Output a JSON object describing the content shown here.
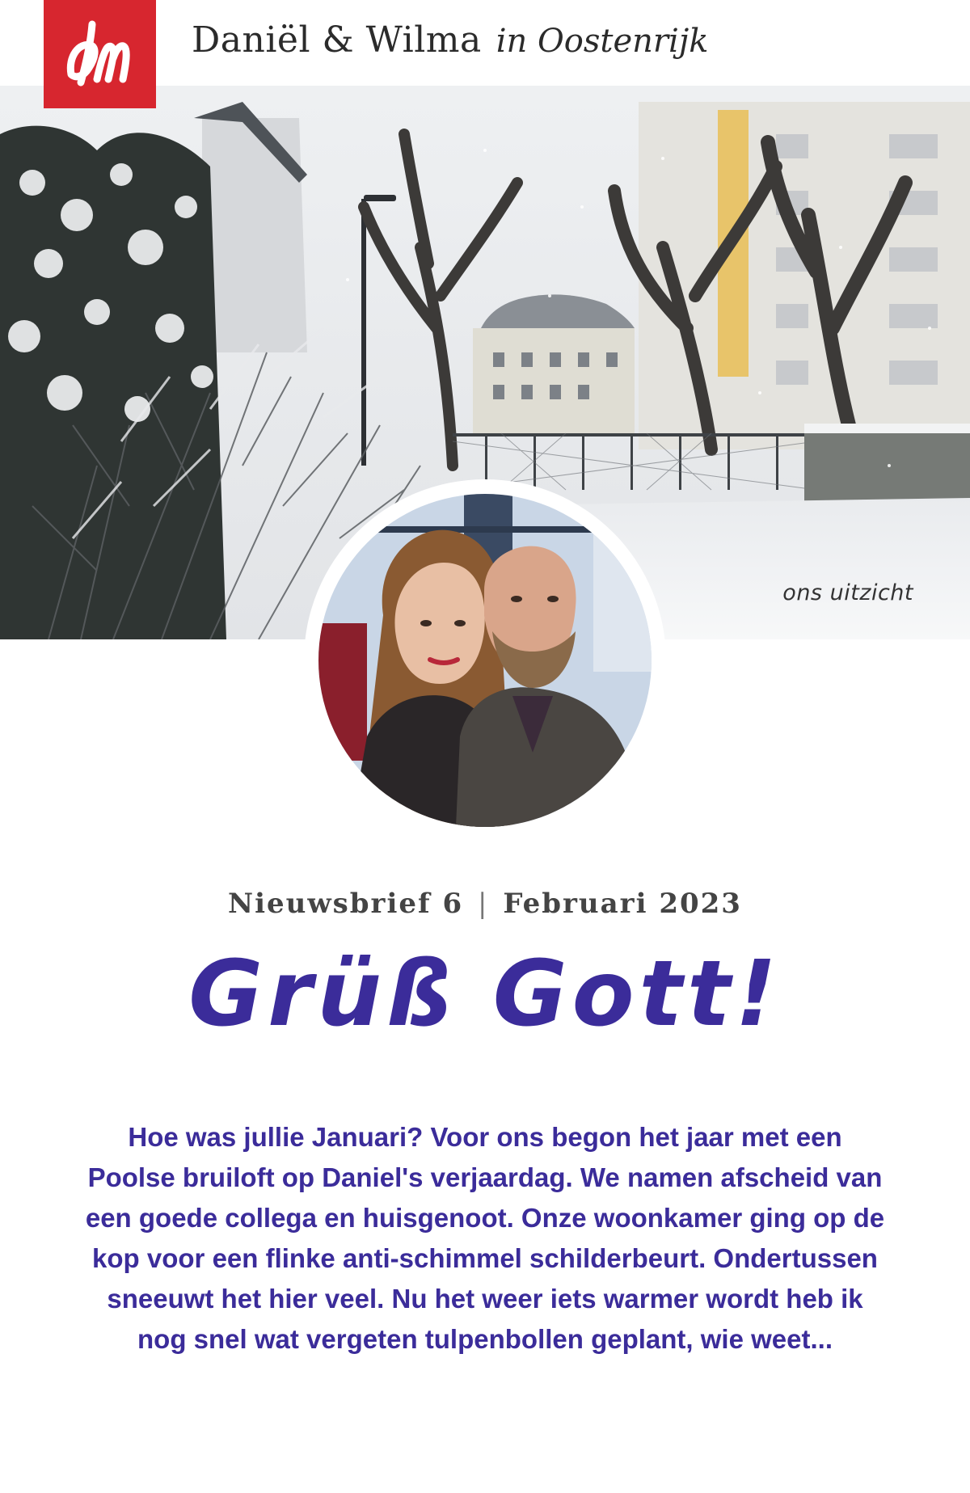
{
  "header": {
    "logo_monogram": "dm",
    "site_title_names": "Daniël & Wilma",
    "site_title_place": "in Oostenrijk"
  },
  "hero": {
    "caption": "ons uitzicht"
  },
  "newsletter": {
    "issue": "Nieuwsbrief 6",
    "separator": "|",
    "date": "Februari 2023",
    "headline": "Grüß Gott!",
    "intro": "Hoe was jullie Januari? Voor ons begon het jaar met een Poolse bruiloft op Daniel's verjaardag. We namen afscheid van een goede collega en huisgenoot. Onze woonkamer ging op de kop voor een flinke anti-schimmel schilderbeurt. Ondertussen sneeuwt het hier veel. Nu het weer iets warmer wordt heb ik nog snel wat vergeten tulpenbollen geplant, wie weet..."
  },
  "colors": {
    "brand_red": "#d7262f",
    "accent_purple": "#3b2c9a",
    "text_dark": "#2b2b2b"
  }
}
